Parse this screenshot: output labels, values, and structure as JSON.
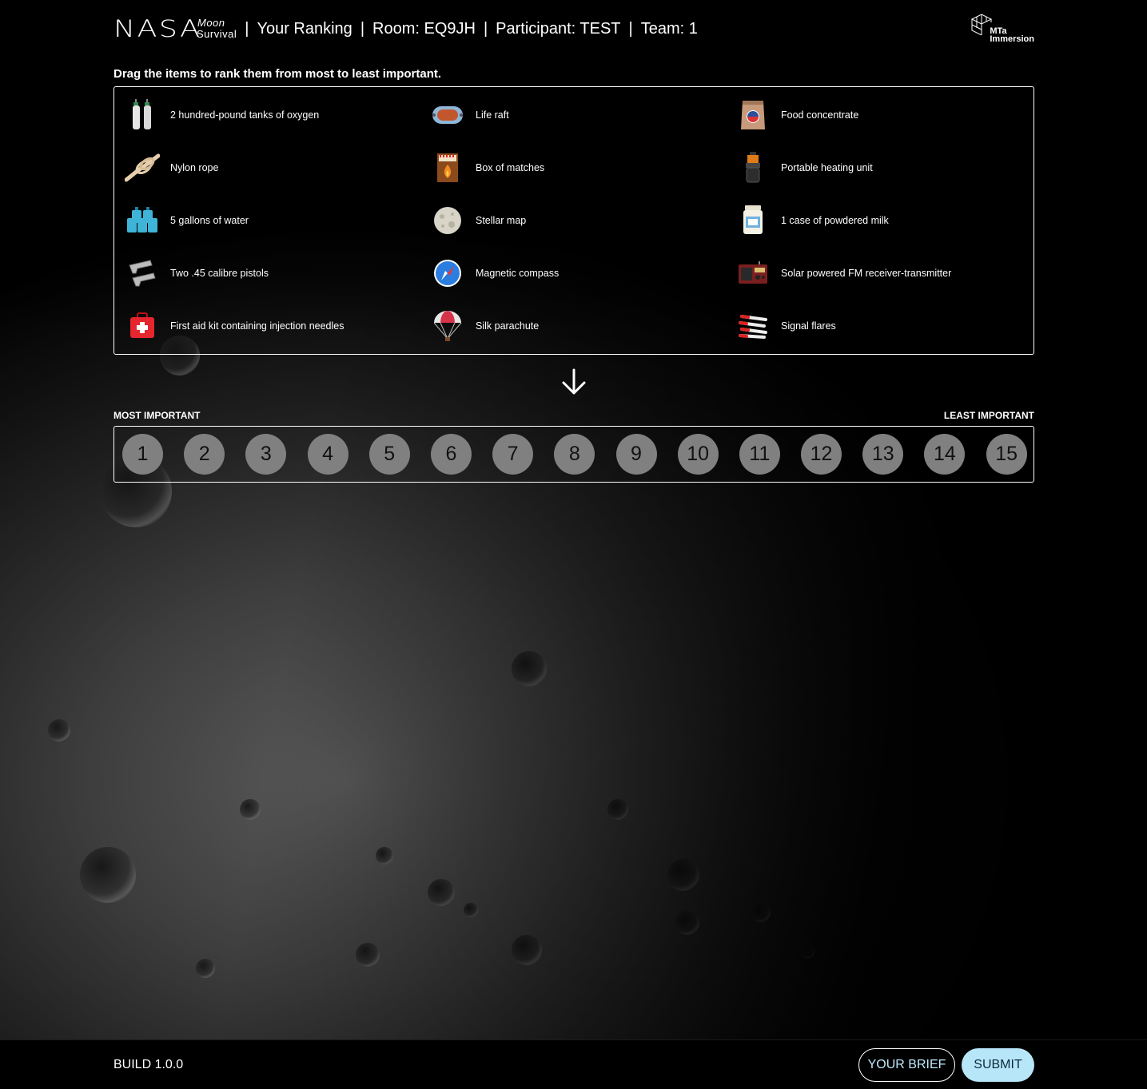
{
  "header": {
    "logo": "NASA",
    "subtitle_line1": "Moon",
    "subtitle_line2": "Survival",
    "section": "Your Ranking",
    "room": "Room: EQ9JH",
    "participant": "Participant: TEST",
    "team": "Team: 1",
    "partner_logo_line1": "MTa",
    "partner_logo_line2": "Immersion"
  },
  "instruction": "Drag the items to rank them from most to least important.",
  "items": [
    {
      "label": "2 hundred-pound tanks of oxygen",
      "icon": "oxygen-tanks-icon"
    },
    {
      "label": "Life raft",
      "icon": "life-raft-icon"
    },
    {
      "label": "Food concentrate",
      "icon": "food-bag-icon"
    },
    {
      "label": "Nylon rope",
      "icon": "rope-icon"
    },
    {
      "label": "Box of matches",
      "icon": "matches-icon"
    },
    {
      "label": "Portable heating unit",
      "icon": "heater-icon"
    },
    {
      "label": "5 gallons of water",
      "icon": "water-jugs-icon"
    },
    {
      "label": "Stellar map",
      "icon": "moon-map-icon"
    },
    {
      "label": "1 case of powdered milk",
      "icon": "milk-jar-icon"
    },
    {
      "label": "Two .45 calibre pistols",
      "icon": "pistols-icon"
    },
    {
      "label": "Magnetic compass",
      "icon": "compass-icon"
    },
    {
      "label": "Solar powered FM receiver-transmitter",
      "icon": "radio-icon"
    },
    {
      "label": "First aid kit containing injection needles",
      "icon": "first-aid-icon"
    },
    {
      "label": "Silk parachute",
      "icon": "parachute-icon"
    },
    {
      "label": "Signal flares",
      "icon": "flares-icon"
    }
  ],
  "ranking": {
    "most_label": "MOST IMPORTANT",
    "least_label": "LEAST IMPORTANT",
    "slots": [
      "1",
      "2",
      "3",
      "4",
      "5",
      "6",
      "7",
      "8",
      "9",
      "10",
      "11",
      "12",
      "13",
      "14",
      "15"
    ]
  },
  "footer": {
    "build": "BUILD 1.0.0",
    "brief_button": "YOUR BRIEF",
    "submit_button": "SUBMIT"
  },
  "colors": {
    "accent": "#b8e6f9",
    "slot_fill": "#808080"
  }
}
